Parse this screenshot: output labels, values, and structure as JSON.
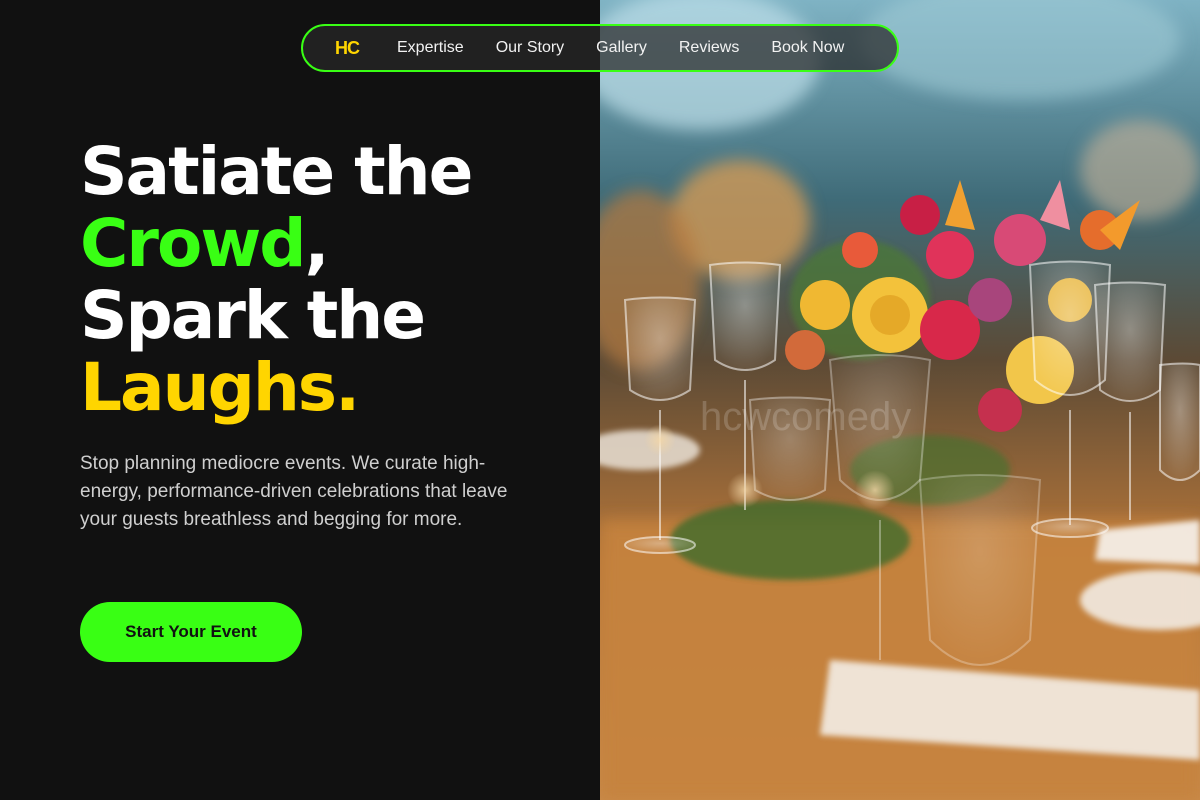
{
  "nav": {
    "logo": "HC",
    "links": [
      "Expertise",
      "Our Story",
      "Gallery",
      "Reviews",
      "Book Now"
    ]
  },
  "hero": {
    "headline": {
      "line1": "Satiate the",
      "line2_accent": "Crowd",
      "line2_rest": ",",
      "line3": "Spark the",
      "line4_accent": "Laughs",
      "line4_rest": "."
    },
    "subtext": "Stop planning mediocre events. We curate high-energy, performance-driven celebrations that leave your guests breathless and begging for more.",
    "cta_label": "Start Your Event"
  },
  "image": {
    "subject": "banquet-table-with-flowers-and-glassware",
    "watermark": "hcwcomedy"
  },
  "colors": {
    "background": "#111111",
    "accent_green": "#39ff14",
    "accent_yellow": "#ffd500",
    "text_white": "#ffffff",
    "text_muted": "#cfcfcf"
  }
}
